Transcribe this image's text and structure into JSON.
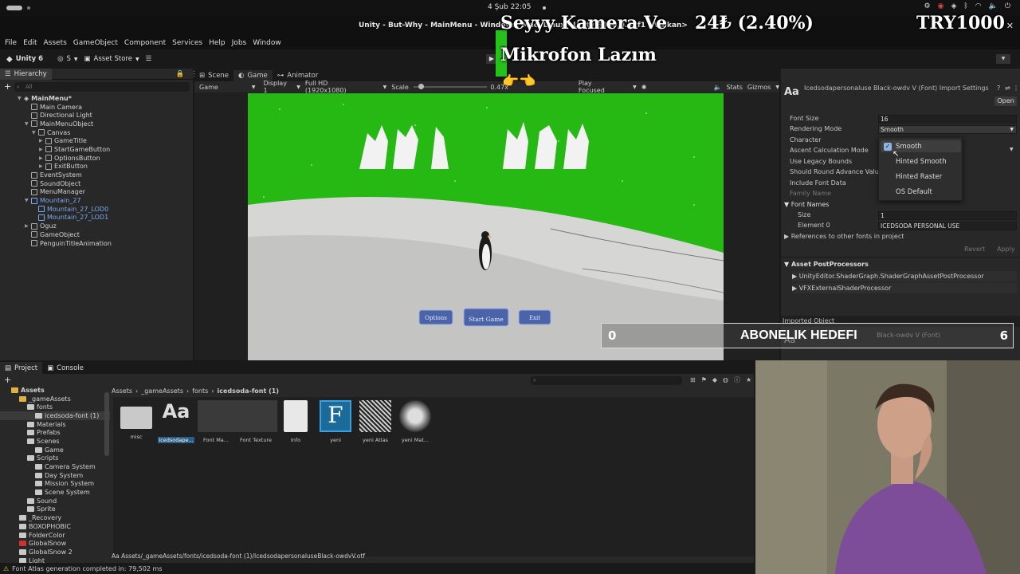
{
  "system": {
    "clock": "4 Şub  22:05"
  },
  "window": {
    "title": "Unity - But-Why - MainMenu - Windows, Mac, Linux - Unity 6000.0.32f1 <Vulkan>"
  },
  "menu": [
    "File",
    "Edit",
    "Assets",
    "GameObject",
    "Component",
    "Services",
    "Help",
    "Jobs",
    "Window"
  ],
  "toolbar": {
    "unity": "Unity 6",
    "account": "S",
    "asset_store": "Asset Store"
  },
  "hierarchy": {
    "tab": "Hierarchy",
    "search_placeholder": "All",
    "items": [
      {
        "label": "MainMenu*",
        "depth": 0,
        "expanded": true,
        "kind": "scene"
      },
      {
        "label": "Main Camera",
        "depth": 1
      },
      {
        "label": "Directional Light",
        "depth": 1
      },
      {
        "label": "MainMenuObject",
        "depth": 1,
        "expanded": true
      },
      {
        "label": "Canvas",
        "depth": 2,
        "expanded": true
      },
      {
        "label": "GameTitle",
        "depth": 3,
        "collapsed": true
      },
      {
        "label": "StartGameButton",
        "depth": 3,
        "collapsed": true
      },
      {
        "label": "OptionsButton",
        "depth": 3,
        "collapsed": true
      },
      {
        "label": "ExitButton",
        "depth": 3,
        "collapsed": true
      },
      {
        "label": "EventSystem",
        "depth": 1
      },
      {
        "label": "SoundObject",
        "depth": 1
      },
      {
        "label": "MenuManager",
        "depth": 1
      },
      {
        "label": "Mountain_27",
        "depth": 1,
        "expanded": true,
        "prefab": true
      },
      {
        "label": "Mountain_27_LOD0",
        "depth": 2,
        "prefab": true
      },
      {
        "label": "Mountain_27_LOD1",
        "depth": 2,
        "prefab": true
      },
      {
        "label": "Oguz",
        "depth": 1,
        "collapsed": true
      },
      {
        "label": "GameObject",
        "depth": 1
      },
      {
        "label": "PenguinTitleAnimation",
        "depth": 1
      }
    ]
  },
  "game_view": {
    "tabs": [
      "Scene",
      "Game",
      "Animator"
    ],
    "mode": "Game",
    "display": "Display 1",
    "resolution": "Full HD (1920x1080)",
    "scale_label": "Scale",
    "scale_value": "0.47x",
    "play_mode": "Play Focused",
    "stats": "Stats",
    "gizmos": "Gizmos",
    "buttons": [
      "Options",
      "Start Game",
      "Exit"
    ]
  },
  "inspector": {
    "title": "Icedsodapersonaluse Black-owdv V (Font) Import Settings",
    "open_button": "Open",
    "fields": [
      {
        "label": "Font Size",
        "value": "16"
      },
      {
        "label": "Rendering Mode",
        "value": "Smooth"
      },
      {
        "label": "Character",
        "value": ""
      },
      {
        "label": "Ascent Calculation Mode",
        "value": ""
      },
      {
        "label": "Use Legacy Bounds",
        "value": ""
      },
      {
        "label": "Should Round Advance Value",
        "value": ""
      },
      {
        "label": "Include Font Data",
        "value": ""
      },
      {
        "label": "Family Name",
        "value": ""
      }
    ],
    "font_names": {
      "header": "Font Names",
      "size_label": "Size",
      "size": "1",
      "element_label": "Element 0",
      "element": "ICEDSODA PERSONAL USE"
    },
    "references": "References to other fonts in project",
    "revert": "Revert",
    "apply": "Apply",
    "post_processors": {
      "header": "Asset PostProcessors",
      "items": [
        "UnityEditor.ShaderGraph.ShaderGraphAssetPostProcessor",
        "VFXExternalShaderProcessor"
      ]
    },
    "imported_object": "Imported Object",
    "imported_name": "Black-owdv V (Font)"
  },
  "dropdown": {
    "options": [
      "Smooth",
      "Hinted Smooth",
      "Hinted Raster",
      "OS Default"
    ],
    "selected": "Smooth"
  },
  "project": {
    "tabs": [
      "Project",
      "Console"
    ],
    "breadcrumb": [
      "Assets",
      "_gameAssets",
      "fonts",
      "icedsoda-font (1)"
    ],
    "tree": [
      {
        "label": "Assets",
        "depth": 0,
        "bold": true
      },
      {
        "label": "_gameAssets",
        "depth": 1
      },
      {
        "label": "fonts",
        "depth": 2
      },
      {
        "label": "icedsoda-font (1)",
        "depth": 3,
        "selected": true
      },
      {
        "label": "Materials",
        "depth": 2
      },
      {
        "label": "Prefabs",
        "depth": 2
      },
      {
        "label": "Scenes",
        "depth": 2
      },
      {
        "label": "Game",
        "depth": 3
      },
      {
        "label": "Scripts",
        "depth": 2
      },
      {
        "label": "Camera System",
        "depth": 3
      },
      {
        "label": "Day System",
        "depth": 3
      },
      {
        "label": "Mission System",
        "depth": 3
      },
      {
        "label": "Scene System",
        "depth": 3
      },
      {
        "label": "Sound",
        "depth": 2
      },
      {
        "label": "Sprite",
        "depth": 2
      },
      {
        "label": "_Recovery",
        "depth": 1
      },
      {
        "label": "BOXOPHOBIC",
        "depth": 1
      },
      {
        "label": "FolderColor",
        "depth": 1
      },
      {
        "label": "GlobalSnow",
        "depth": 1,
        "red": true
      },
      {
        "label": "GlobalSnow 2",
        "depth": 1
      },
      {
        "label": "Light",
        "depth": 1
      }
    ],
    "assets": [
      {
        "label": "misc",
        "type": "folder"
      },
      {
        "label": "Icedsodape...",
        "type": "font",
        "selected": true
      },
      {
        "label": "Font Ma...",
        "type": "material"
      },
      {
        "label": "Font Texture",
        "type": "texture"
      },
      {
        "label": "Info",
        "type": "doc"
      },
      {
        "label": "yeni",
        "type": "fontasset"
      },
      {
        "label": "yeni Atlas",
        "type": "atlas"
      },
      {
        "label": "yeni Mat...",
        "type": "material2"
      }
    ],
    "path": "Assets/_gameAssets/fonts/icedsoda-font (1)/IcedsodapersonaluseBlack-owdvV.otf"
  },
  "status": "Font Atlas generation completed in: 79,502 ms",
  "overlay": {
    "line1": "Seyyy Kamera Ve",
    "line2": "Mikrofon Lazım",
    "price": "24₺ (2.40%)",
    "goal_amount": "TRY1000",
    "goal_left": "0",
    "goal_title": "ABONELIK HEDEFI",
    "goal_right": "6",
    "pointers": "👉👈"
  },
  "colors": {
    "accent": "#2d5e9e",
    "greenscreen": "#27b913",
    "selected": "#2c5d87"
  }
}
